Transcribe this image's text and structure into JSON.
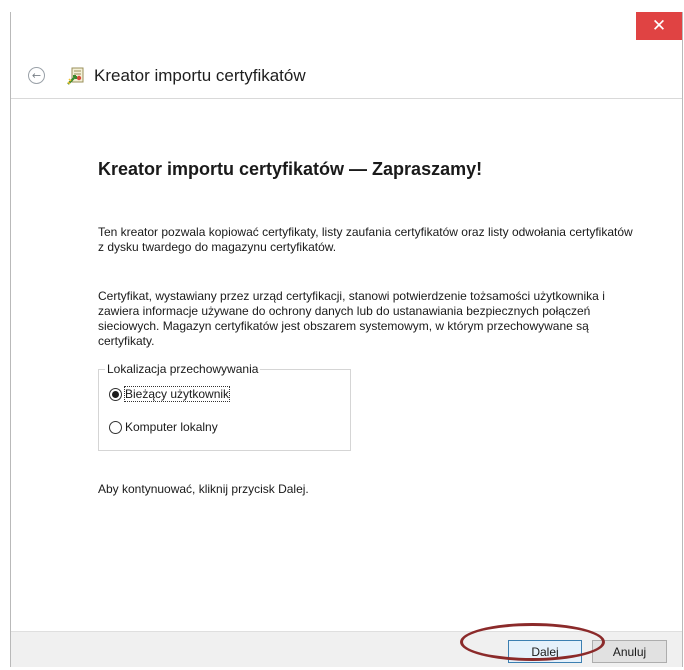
{
  "window": {
    "close_label": "✕"
  },
  "header": {
    "back_glyph": "←",
    "title": "Kreator importu certyfikatów"
  },
  "content": {
    "page_title": "Kreator importu certyfikatów — Zapraszamy!",
    "paragraph1": "Ten kreator pozwala kopiować certyfikaty, listy zaufania certyfikatów oraz listy odwołania certyfikatów z dysku twardego do magazynu certyfikatów.",
    "paragraph2": "Certyfikat, wystawiany przez urząd certyfikacji, stanowi potwierdzenie tożsamości użytkownika i zawiera informacje używane do ochrony danych lub do ustanawiania bezpiecznych połączeń sieciowych. Magazyn certyfikatów jest obszarem systemowym, w którym przechowywane są certyfikaty.",
    "store_location": {
      "legend": "Lokalizacja przechowywania",
      "options": [
        {
          "label": "Bieżący użytkownik",
          "selected": true
        },
        {
          "label": "Komputer lokalny",
          "selected": false
        }
      ]
    },
    "continue_text": "Aby kontynuować, kliknij przycisk Dalej."
  },
  "footer": {
    "next_label": "Dalej",
    "cancel_label": "Anuluj"
  },
  "colors": {
    "close_button": "#e04343",
    "annotation_ellipse": "#8b2a2a",
    "default_button_border": "#3c7fb1"
  },
  "icons": {
    "back": "back-arrow-icon",
    "wizard": "certificate-wizard-icon",
    "close": "close-icon"
  }
}
